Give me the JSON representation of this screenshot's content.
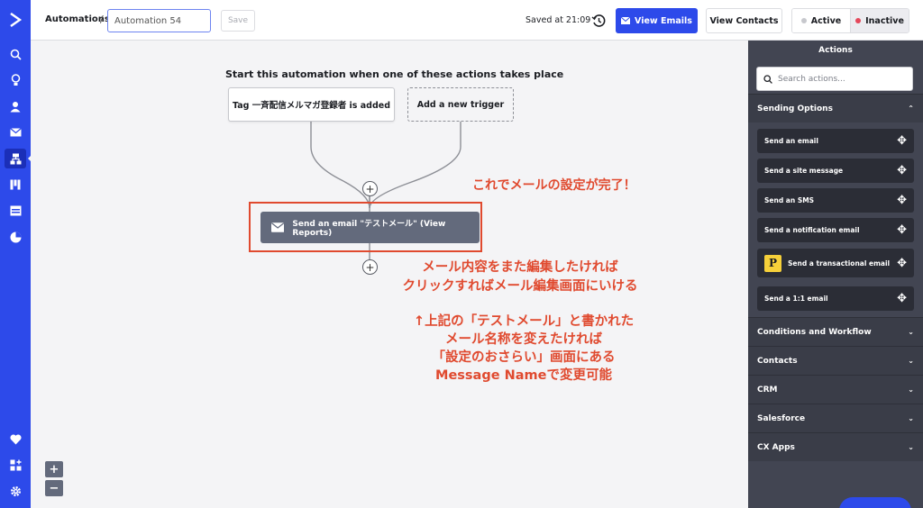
{
  "header": {
    "breadcrumb": "Automations",
    "separator": "/",
    "automation_name": "Automation 54",
    "save_label": "Save",
    "saved_status": "Saved at 21:09",
    "view_emails_label": "View Emails",
    "view_contacts_label": "View Contacts",
    "status_active": "Active",
    "status_inactive": "Inactive"
  },
  "canvas": {
    "start_label": "Start this automation when one of these actions takes place",
    "triggers": [
      "Tag 一斉配信メルマガ登録者 is added",
      "Add a new trigger"
    ],
    "email_step": "Send an email \"テストメール\" (View Reports)",
    "zoom_in": "+",
    "zoom_out": "−"
  },
  "annotations": {
    "note1": "これでメールの設定が完了！",
    "note2_line1": "メール内容をまた編集したければ",
    "note2_line2": "クリックすればメール編集画面にいける",
    "note3_line1": "↑上記の「テストメール」と書かれた",
    "note3_line2": "メール名称を変えたければ",
    "note3_line3": "「設定のおさらい」画面にある",
    "note3_line4": "Message Nameで変更可能"
  },
  "actions_panel": {
    "title": "Actions",
    "search_placeholder": "Search actions...",
    "sections": {
      "sending_options": "Sending Options",
      "conditions_workflow": "Conditions and Workflow",
      "contacts": "Contacts",
      "crm": "CRM",
      "salesforce": "Salesforce",
      "cx_apps": "CX Apps"
    },
    "sending_items": [
      "Send an email",
      "Send a site message",
      "Send an SMS",
      "Send a notification email",
      "Send a transactional email",
      "Send a 1:1 email"
    ],
    "transactional_logo": "P"
  },
  "colors": {
    "brand_blue": "#2d4aea",
    "annotation_red": "#e04a2f",
    "panel_bg": "#424552",
    "node_gray": "#636a7c",
    "inactive_dot": "#e5475b",
    "active_dot": "#c7c8cd"
  },
  "icons": {
    "rail": [
      "logo-chevron-icon",
      "search-icon",
      "lightbulb-icon",
      "contact-icon",
      "mail-icon",
      "automation-icon",
      "pipeline-icon",
      "site-icon",
      "reports-icon",
      "heart-icon",
      "apps-icon",
      "settings-icon"
    ]
  }
}
